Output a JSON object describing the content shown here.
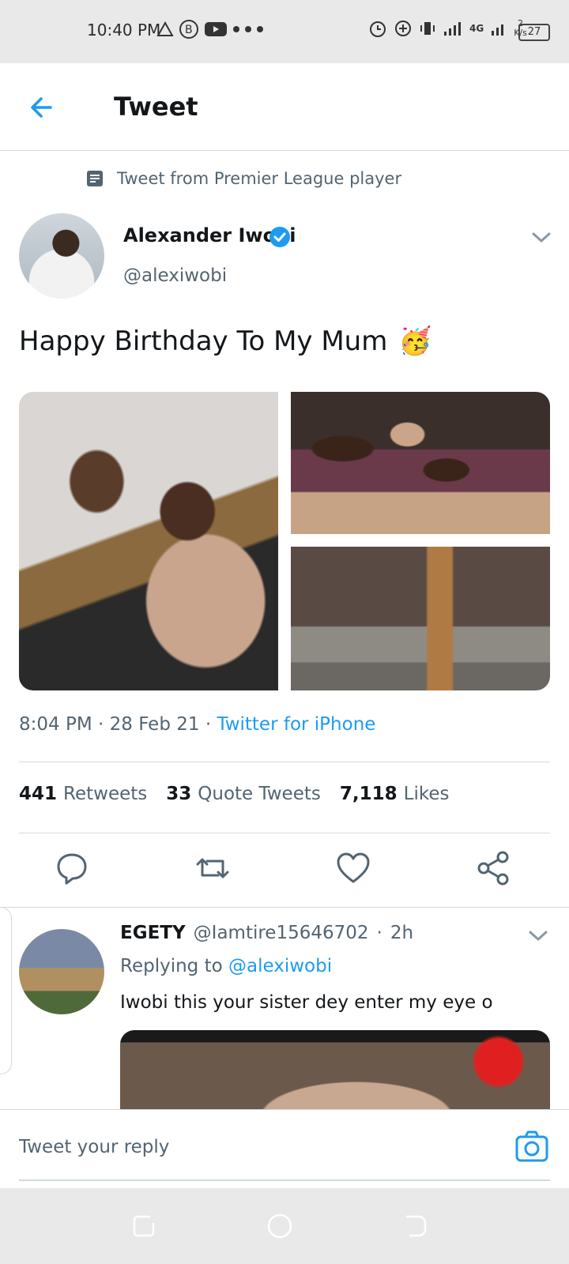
{
  "status_bar": {
    "time": "10:40 PM",
    "network_label": "4G",
    "speed_value": "2",
    "speed_unit": "K/s",
    "battery": "27"
  },
  "header": {
    "title": "Tweet"
  },
  "tweet": {
    "context": "Tweet from Premier League player",
    "author_name": "Alexander Iwobi",
    "author_handle": "@alexiwobi",
    "text": "Happy Birthday To My Mum",
    "emoji": "🥳",
    "time": "8:04 PM",
    "date": "28 Feb 21",
    "app": "Twitter for iPhone",
    "retweets_count": "441",
    "retweets_label": "Retweets",
    "quotes_count": "33",
    "quotes_label": "Quote Tweets",
    "likes_count": "7,118",
    "likes_label": "Likes"
  },
  "reply": {
    "name": "EGETY",
    "handle": "@Iamtire15646702",
    "age": "2h",
    "replying_prefix": "Replying to",
    "replying_to": "@alexiwobi",
    "text": "Iwobi this your sister dey enter my eye o"
  },
  "compose": {
    "placeholder": "Tweet your reply"
  },
  "colors": {
    "accent": "#1d9bf0",
    "secondary_text": "#536471",
    "divider": "#d5d8dc"
  },
  "icons": [
    "arrow-left-icon",
    "document-icon",
    "verified-badge-icon",
    "chevron-down-icon",
    "reply-icon",
    "retweet-icon",
    "like-icon",
    "share-icon",
    "camera-icon"
  ]
}
